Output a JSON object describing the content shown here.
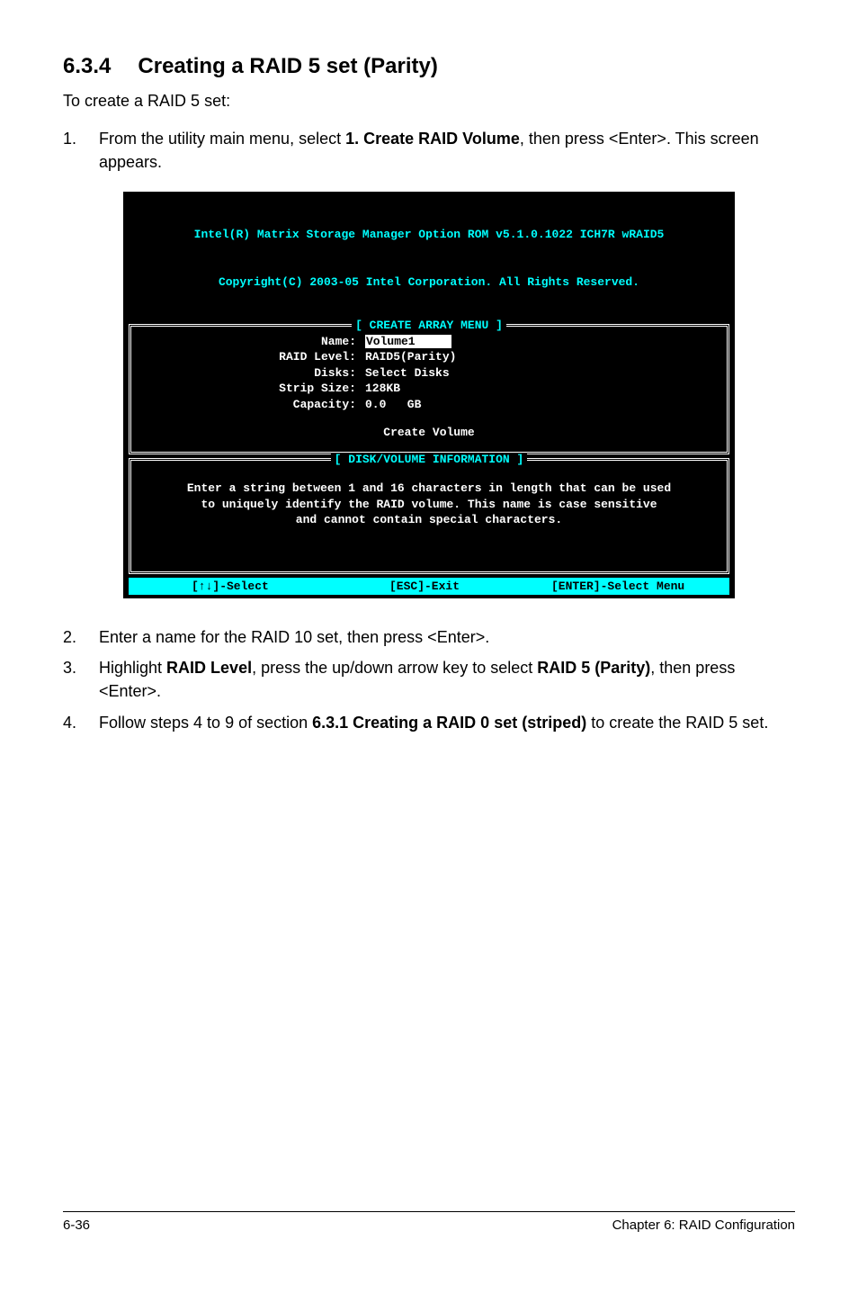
{
  "section": {
    "number": "6.3.4",
    "title": "Creating a RAID 5 set (Parity)"
  },
  "intro": "To create a RAID 5 set:",
  "step1": {
    "num": "1.",
    "text_pre": "From the utility main menu, select ",
    "text_bold": "1. Create RAID Volume",
    "text_post": ", then press <Enter>. This screen appears."
  },
  "bios": {
    "header_line1": "Intel(R) Matrix Storage Manager Option ROM v5.1.0.1022 ICH7R wRAID5",
    "header_line2": "Copyright(C) 2003-05 Intel Corporation. All Rights Reserved.",
    "box1_label": "[ CREATE ARRAY MENU ]",
    "fields": {
      "name_label": "Name:",
      "name_value": "Volume1     ",
      "raid_level_label": "RAID Level:",
      "raid_level_value": "RAID5(Parity)",
      "disks_label": "Disks:",
      "disks_value": "Select Disks",
      "strip_label": "Strip Size:",
      "strip_value": "128KB",
      "capacity_label": "Capacity:",
      "capacity_value": "0.0   GB"
    },
    "create_volume": "Create Volume",
    "box2_label": "[ DISK/VOLUME INFORMATION ]",
    "info_text": "Enter a string between 1 and 16 characters in length that can be used\nto uniquely identify the RAID volume. This name is case sensitive\nand cannot contain special characters.",
    "footer": {
      "select": "[↑↓]-Select",
      "exit": "[ESC]-Exit",
      "enter": "[ENTER]-Select Menu"
    }
  },
  "step2": {
    "num": "2.",
    "text": "Enter a name for the RAID 10  set, then press <Enter>."
  },
  "step3": {
    "num": "3.",
    "pre": "Highlight ",
    "b1": "RAID Level",
    "mid": ", press the up/down arrow key to select ",
    "b2": "RAID 5 (Parity)",
    "post": ", then press <Enter>."
  },
  "step4": {
    "num": "4.",
    "pre": "Follow steps 4 to 9 of section ",
    "b1": "6.3.1 Creating a RAID 0 set (striped)",
    "post": " to create the RAID 5 set."
  },
  "footer": {
    "left": "6-36",
    "right": "Chapter 6: RAID Configuration"
  }
}
